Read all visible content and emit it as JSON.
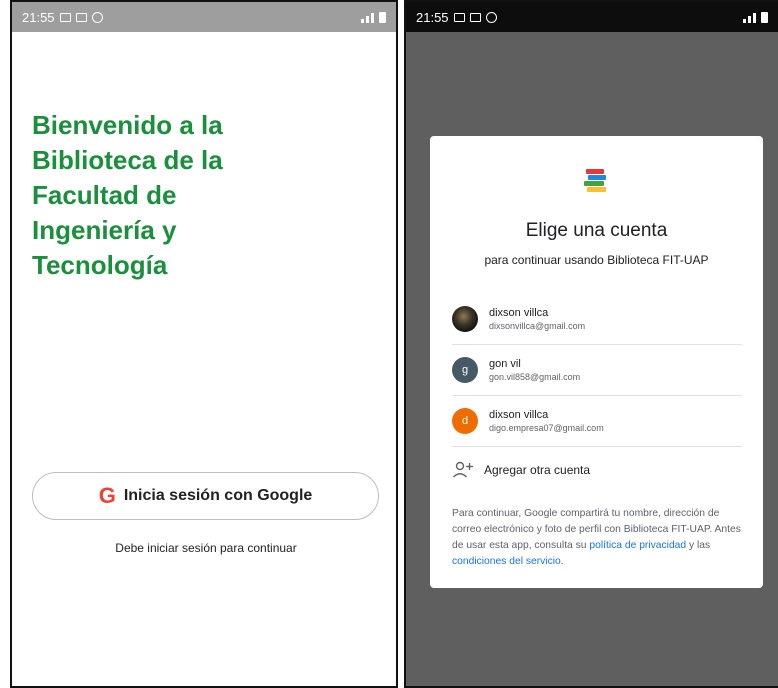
{
  "left_screen": {
    "status_time": "21:55",
    "welcome_title_lines": [
      "Bienvenido a la",
      "Biblioteca de la",
      "Facultad de",
      "Ingeniería y",
      "Tecnología"
    ],
    "google_button": {
      "icon": "google-g-icon",
      "label": "Inicia sesión con Google"
    },
    "hint": "Debe iniciar sesión para continuar",
    "colors": {
      "title": "#1a8f3c",
      "google_g": "#ea4335"
    }
  },
  "right_screen": {
    "status_time": "21:55",
    "dialog": {
      "app_icon": "books-icon",
      "title": "Elige una cuenta",
      "subtitle": "para continuar usando Biblioteca FIT-UAP",
      "accounts": [
        {
          "name": "dixson villca",
          "email": "dixsonvillca@gmail.com",
          "avatar": "",
          "avatar_color": "#2b2b2b"
        },
        {
          "name": "gon vil",
          "email": "gon.vil858@gmail.com",
          "avatar": "g",
          "avatar_color": "#455a64"
        },
        {
          "name": "dixson villca",
          "email": "digo.empresa07@gmail.com",
          "avatar": "d",
          "avatar_color": "#ef6c00"
        }
      ],
      "add_account": {
        "icon": "add-person-icon",
        "label": "Agregar otra cuenta"
      },
      "disclaimer": {
        "text_1": "Para continuar, Google compartirá tu nombre, dirección de correo electrónico y foto de perfil con Biblioteca FIT-UAP. Antes de usar esta app, consulta su ",
        "privacy_link": "política de privacidad",
        "text_2": " y las ",
        "terms_link": "condiciones del servicio",
        "text_3": "."
      }
    }
  }
}
